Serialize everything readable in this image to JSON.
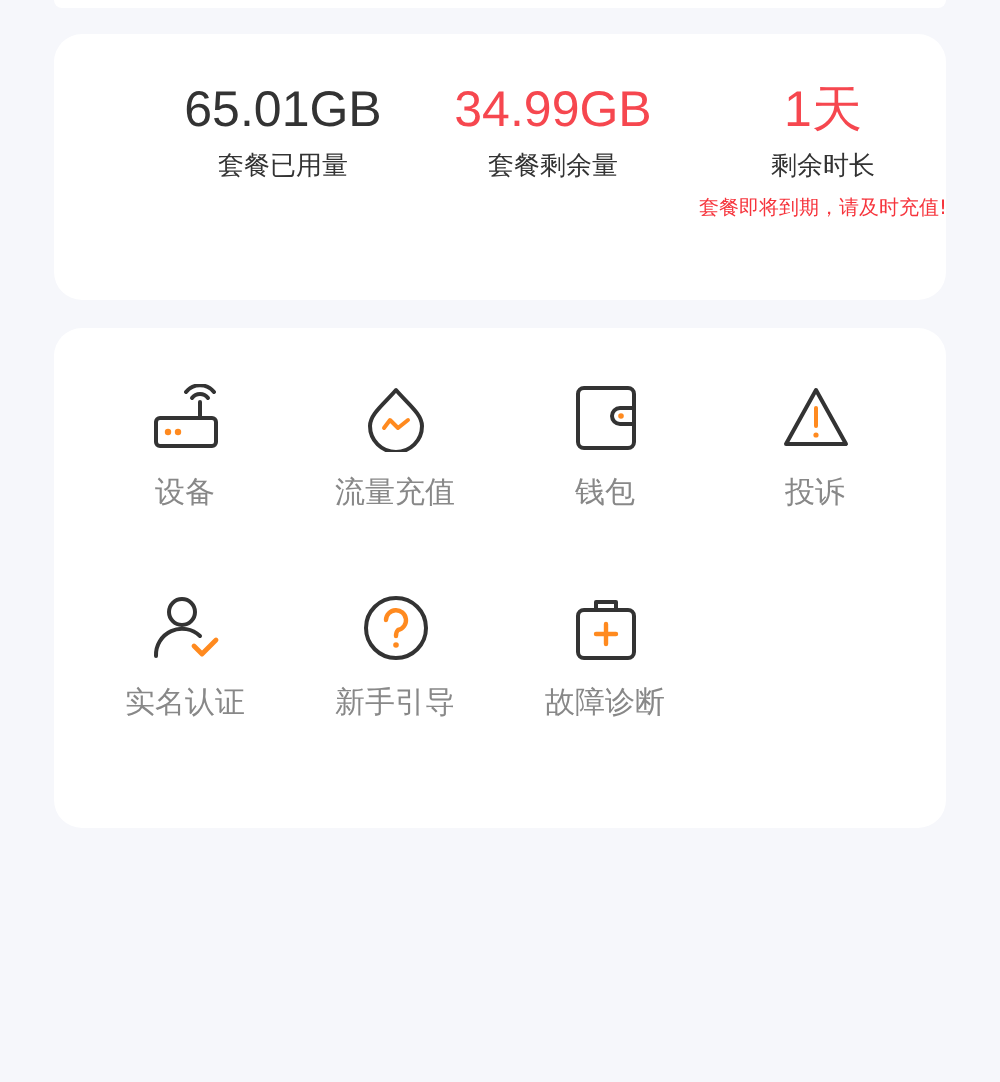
{
  "stats": [
    {
      "value": "65.01GB",
      "label": "套餐已用量",
      "alert": false
    },
    {
      "value": "34.99GB",
      "label": "套餐剩余量",
      "alert": true
    },
    {
      "value": "1天",
      "label": "剩余时长",
      "alert": true,
      "warning": "套餐即将到期，请及时充值!"
    }
  ],
  "menu": [
    {
      "kind": "router",
      "label": "设备"
    },
    {
      "kind": "drop",
      "label": "流量充值"
    },
    {
      "kind": "wallet",
      "label": "钱包"
    },
    {
      "kind": "warning",
      "label": "投诉"
    },
    {
      "kind": "person",
      "label": "实名认证"
    },
    {
      "kind": "help",
      "label": "新手引导"
    },
    {
      "kind": "kit",
      "label": "故障诊断"
    }
  ]
}
